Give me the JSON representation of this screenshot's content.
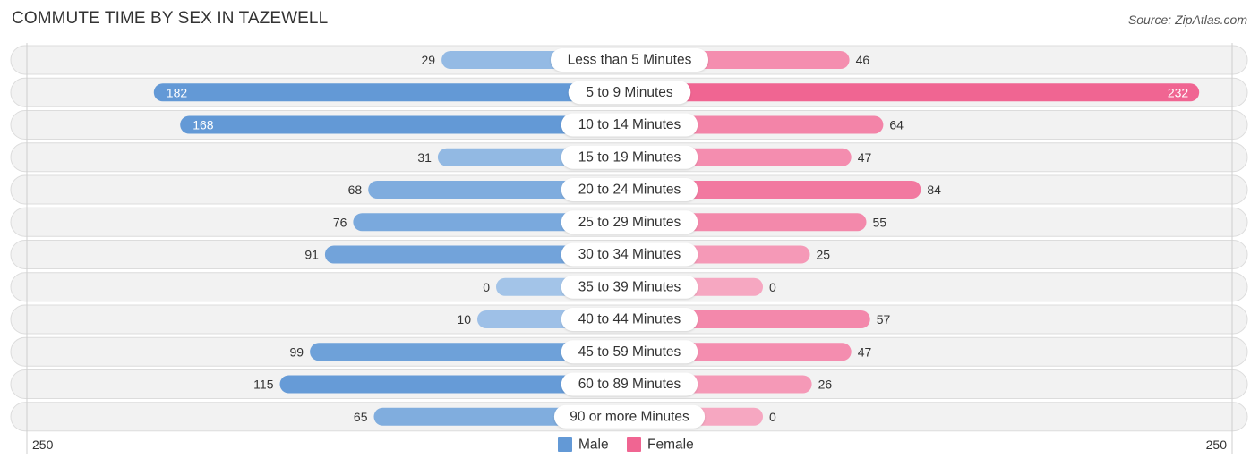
{
  "header": {
    "title": "COMMUTE TIME BY SEX IN TAZEWELL",
    "source": "Source: ZipAtlas.com"
  },
  "colors": {
    "male": "#6399d6",
    "male_light": "#a3c4e8",
    "female": "#f06592",
    "female_light": "#f6a7c1",
    "row_bg": "#f2f2f2",
    "row_border": "#dcdcdc"
  },
  "chart_data": {
    "type": "bar",
    "orientation": "horizontal-diverging",
    "title": "COMMUTE TIME BY SEX IN TAZEWELL",
    "categories": [
      "Less than 5 Minutes",
      "5 to 9 Minutes",
      "10 to 14 Minutes",
      "15 to 19 Minutes",
      "20 to 24 Minutes",
      "25 to 29 Minutes",
      "30 to 34 Minutes",
      "35 to 39 Minutes",
      "40 to 44 Minutes",
      "45 to 59 Minutes",
      "60 to 89 Minutes",
      "90 or more Minutes"
    ],
    "series": [
      {
        "name": "Male",
        "values": [
          29,
          182,
          168,
          31,
          68,
          76,
          91,
          0,
          10,
          99,
          115,
          65
        ]
      },
      {
        "name": "Female",
        "values": [
          46,
          232,
          64,
          47,
          84,
          55,
          25,
          0,
          57,
          47,
          26,
          0
        ]
      }
    ],
    "axis": {
      "left_label": "250",
      "right_label": "250",
      "range": [
        0,
        250
      ]
    },
    "legend": {
      "position": "bottom-center",
      "items": [
        "Male",
        "Female"
      ]
    },
    "grid": false
  }
}
